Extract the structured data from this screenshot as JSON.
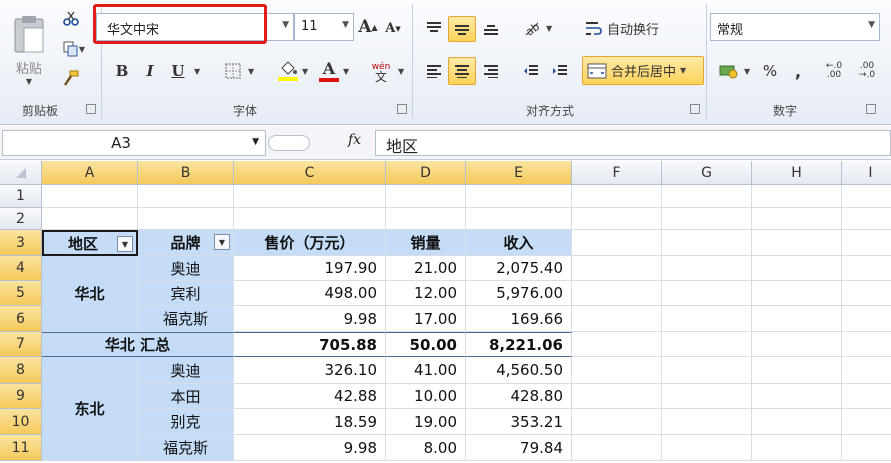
{
  "ribbon": {
    "clipboard": {
      "label": "剪贴板",
      "paste_label": "粘贴"
    },
    "font": {
      "label": "字体",
      "font_name": "华文中宋",
      "font_size": "11",
      "bold": "B",
      "italic": "I",
      "underline": "U",
      "font_color_glyph": "A",
      "grow_glyph": "A",
      "shrink_glyph": "A",
      "phonetic_glyph": "wén"
    },
    "alignment": {
      "label": "对齐方式",
      "wrap_text": "自动换行",
      "merge_center": "合并后居中"
    },
    "number": {
      "label": "数字",
      "format": "常规",
      "percent": "%",
      "comma": ",",
      "inc_decimal": "←.0 .00",
      "dec_decimal": ".00 →.0"
    }
  },
  "formula_bar": {
    "name_box": "A3",
    "fx": "fx",
    "content": "地区"
  },
  "columns": [
    "A",
    "B",
    "C",
    "D",
    "E",
    "F",
    "G",
    "H",
    "I"
  ],
  "rows": [
    "1",
    "2",
    "3",
    "4",
    "5",
    "6",
    "7",
    "8",
    "9",
    "10",
    "11"
  ],
  "pivot": {
    "headers": {
      "region": "地区",
      "brand": "品牌",
      "price": "售价（万元）",
      "qty": "销量",
      "revenue": "收入"
    },
    "groups": [
      {
        "region": "华北",
        "rows": [
          {
            "brand": "奥迪",
            "price": "197.90",
            "qty": "21.00",
            "revenue": "2,075.40"
          },
          {
            "brand": "宾利",
            "price": "498.00",
            "qty": "12.00",
            "revenue": "5,976.00"
          },
          {
            "brand": "福克斯",
            "price": "9.98",
            "qty": "17.00",
            "revenue": "169.66"
          }
        ],
        "subtotal": {
          "label": "华北 汇总",
          "price": "705.88",
          "qty": "50.00",
          "revenue": "8,221.06"
        }
      },
      {
        "region": "东北",
        "rows": [
          {
            "brand": "奥迪",
            "price": "326.10",
            "qty": "41.00",
            "revenue": "4,560.50"
          },
          {
            "brand": "本田",
            "price": "42.88",
            "qty": "10.00",
            "revenue": "428.80"
          },
          {
            "brand": "别克",
            "price": "18.59",
            "qty": "19.00",
            "revenue": "353.21"
          },
          {
            "brand": "福克斯",
            "price": "9.98",
            "qty": "8.00",
            "revenue": "79.84"
          }
        ]
      }
    ]
  },
  "colors": {
    "highlight_box": "#e21b1b",
    "pivot_fill": "#c4dcf5",
    "selected_button": "#ffd35a"
  }
}
